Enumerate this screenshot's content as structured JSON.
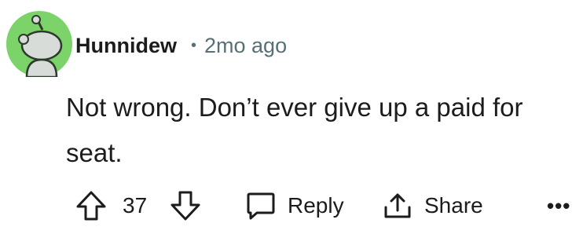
{
  "comment": {
    "author": "Hunnidew",
    "separator": "•",
    "timestamp": "2mo ago",
    "text": "Not wrong. Don’t ever give up a paid for seat.",
    "avatar": {
      "icon": "snoo-avatar-icon",
      "background": "#7bd36a"
    }
  },
  "actions": {
    "upvote_icon": "arrow-up-icon",
    "vote_count": "37",
    "downvote_icon": "arrow-down-icon",
    "reply_icon": "speech-bubble-icon",
    "reply_label": "Reply",
    "share_icon": "share-icon",
    "share_label": "Share",
    "more_label": "•••"
  }
}
